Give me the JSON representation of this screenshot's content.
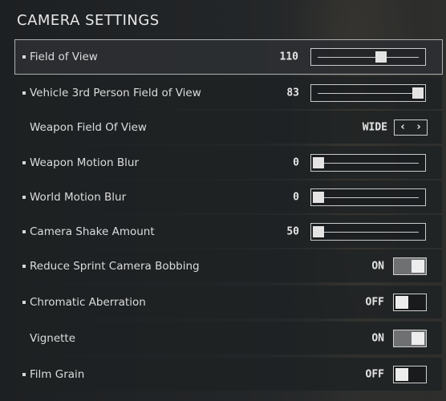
{
  "title": "CAMERA SETTINGS",
  "settings": [
    {
      "label": "Field of View",
      "bullet": true,
      "type": "slider",
      "value": "110",
      "fraction": 0.63,
      "selected": true
    },
    {
      "label": "Vehicle 3rd Person Field of View",
      "bullet": true,
      "type": "slider",
      "value": "83",
      "fraction": 1.0
    },
    {
      "label": "Weapon Field Of View",
      "bullet": false,
      "type": "choice",
      "value": "WIDE",
      "prev_arrow": "‹",
      "next_arrow": "›"
    },
    {
      "label": "Weapon Motion Blur",
      "bullet": true,
      "type": "slider",
      "value": "0",
      "fraction": 0.0
    },
    {
      "label": "World Motion Blur",
      "bullet": true,
      "type": "slider",
      "value": "0",
      "fraction": 0.0
    },
    {
      "label": "Camera Shake Amount",
      "bullet": true,
      "type": "slider",
      "value": "50",
      "fraction": 0.0
    },
    {
      "label": "Reduce Sprint Camera Bobbing",
      "bullet": true,
      "type": "toggle",
      "value": "ON",
      "on": true
    },
    {
      "label": "Chromatic Aberration",
      "bullet": true,
      "type": "toggle",
      "value": "OFF",
      "on": false
    },
    {
      "label": "Vignette",
      "bullet": false,
      "type": "toggle",
      "value": "ON",
      "on": true
    },
    {
      "label": "Film Grain",
      "bullet": true,
      "type": "toggle",
      "value": "OFF",
      "on": false
    }
  ]
}
